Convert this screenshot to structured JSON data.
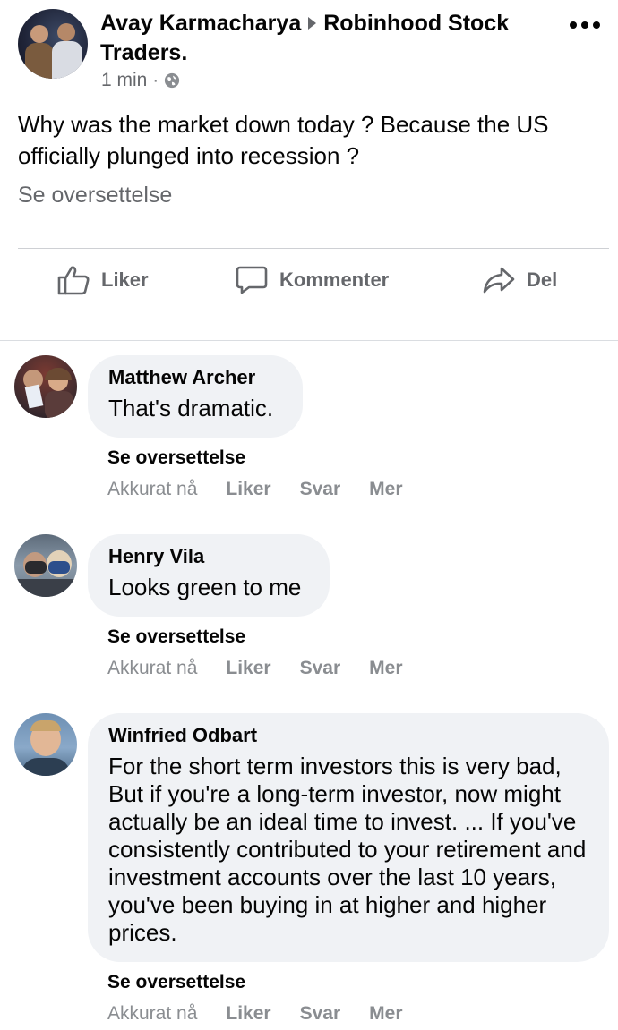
{
  "post": {
    "author": "Avay Karmacharya",
    "group": "Robinhood Stock Traders.",
    "time": "1 min",
    "time_sep": "·",
    "text": "Why was the market down today ? Because the US officially plunged into recession ?",
    "translate": "Se oversettelse"
  },
  "actions": {
    "like": "Liker",
    "comment": "Kommenter",
    "share": "Del"
  },
  "comments": [
    {
      "name": "Matthew Archer",
      "text": "That's dramatic.",
      "translate": "Se oversettelse",
      "time": "Akkurat nå",
      "like": "Liker",
      "reply": "Svar",
      "more": "Mer"
    },
    {
      "name": "Henry Vila",
      "text": "Looks green to me",
      "translate": "Se oversettelse",
      "time": "Akkurat nå",
      "like": "Liker",
      "reply": "Svar",
      "more": "Mer"
    },
    {
      "name": "Winfried Odbart",
      "text": "For the short term investors this is very bad, But if you're a long-term investor, now might actually be an ideal time to invest. ... If you've consistently contributed to your retirement and investment accounts over the last 10 years, you've been buying in at higher and higher prices.",
      "translate": "Se oversettelse",
      "time": "Akkurat nå",
      "like": "Liker",
      "reply": "Svar",
      "more": "Mer"
    }
  ],
  "icons": {
    "more": "more-options-icon",
    "globe": "globe-icon",
    "like": "thumbs-up-icon",
    "comment": "comment-bubble-icon",
    "share": "share-arrow-icon"
  }
}
